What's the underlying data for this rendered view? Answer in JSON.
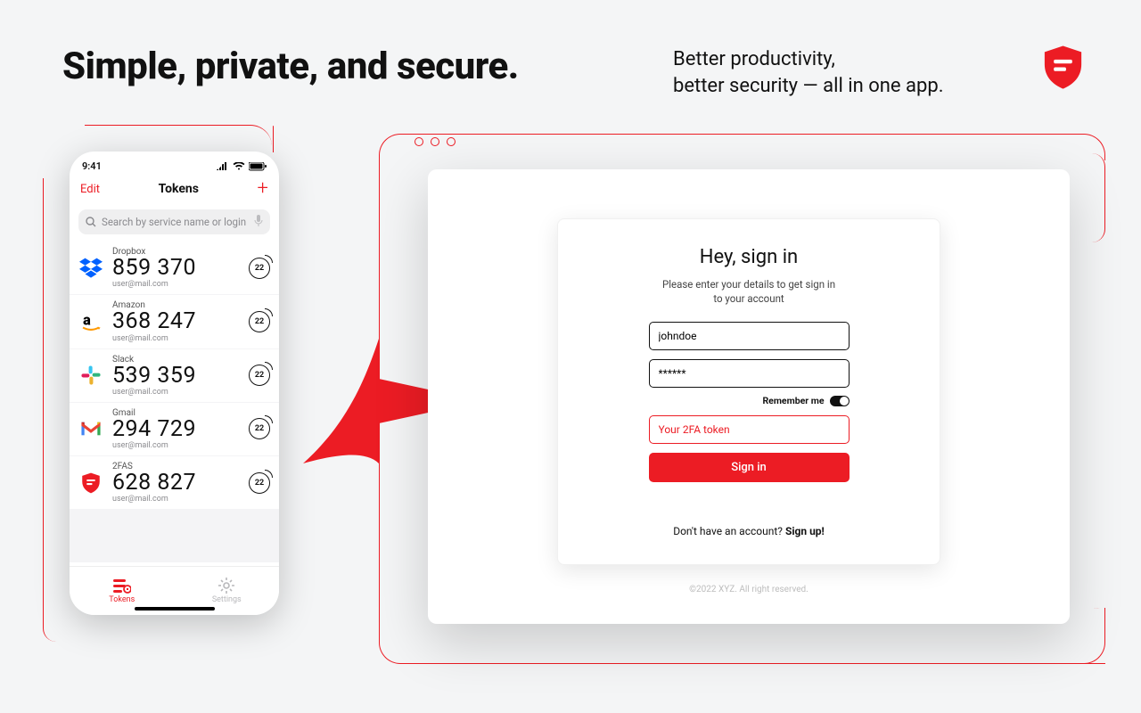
{
  "header": {
    "headline": "Simple, private, and secure.",
    "subhead_l1": "Better productivity,",
    "subhead_l2": "better security — all in one app."
  },
  "phone": {
    "clock": "9:41",
    "edit": "Edit",
    "title": "Tokens",
    "plus": "+",
    "search_placeholder": "Search by service name or login",
    "timer": "22",
    "tokens": [
      {
        "service": "Dropbox",
        "code": "859 370",
        "mail": "user@mail.com"
      },
      {
        "service": "Amazon",
        "code": "368 247",
        "mail": "user@mail.com"
      },
      {
        "service": "Slack",
        "code": "539 359",
        "mail": "user@mail.com"
      },
      {
        "service": "Gmail",
        "code": "294 729",
        "mail": "user@mail.com"
      },
      {
        "service": "2FAS",
        "code": "628 827",
        "mail": "user@mail.com"
      }
    ],
    "tab_tokens": "Tokens",
    "tab_settings": "Settings"
  },
  "signin": {
    "title": "Hey, sign in",
    "sub_l1": "Please enter your details to get sign in",
    "sub_l2": "to your account",
    "username": "johndoe",
    "password": "******",
    "remember": "Remember me",
    "twofa_placeholder": "Your 2FA token",
    "button": "Sign in",
    "signup_q": "Don't have an account? ",
    "signup_cta": "Sign up!",
    "footer": "©2022 XYZ. All right reserved."
  }
}
